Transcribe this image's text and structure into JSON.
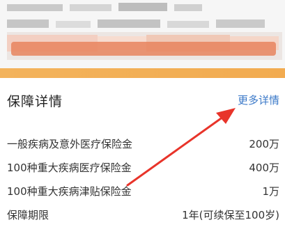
{
  "section": {
    "title": "保障详情",
    "more_label": "更多详情"
  },
  "rows": [
    {
      "label": "一般疾病及意外医疗保险金",
      "value": "200万"
    },
    {
      "label": "100种重大疾病医疗保险金",
      "value": "400万"
    },
    {
      "label": "100种重大疾病津贴保险金",
      "value": "1万"
    },
    {
      "label": "保障期限",
      "value": "1年(可续保至100岁)"
    }
  ],
  "colors": {
    "accent_link": "#3a78c8",
    "arrow": "#e8342a",
    "orange_bar": "#f2ab50"
  }
}
